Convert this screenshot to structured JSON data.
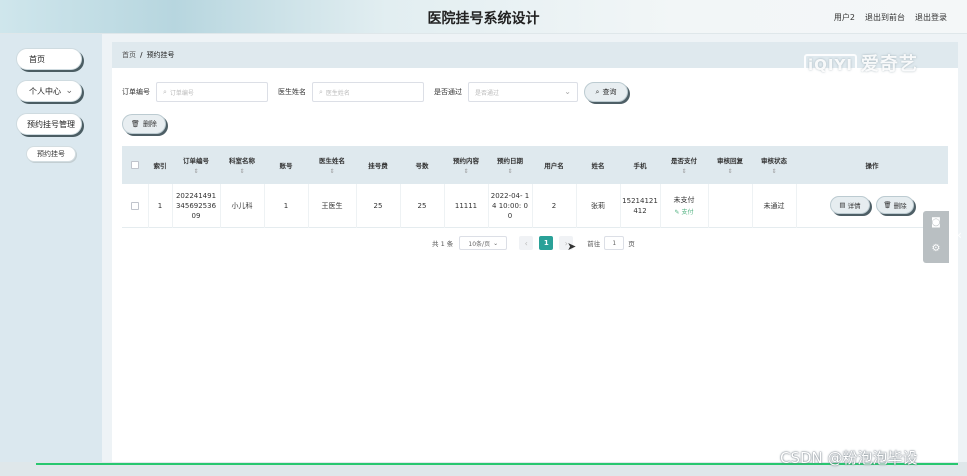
{
  "header": {
    "title": "医院挂号系统设计",
    "user": "用户2",
    "back_to_front": "退出到前台",
    "logout": "退出登录"
  },
  "sidebar": {
    "home": "首页",
    "personal_center": "个人中心",
    "booking_manage": "预约挂号管理",
    "booking": "预约挂号"
  },
  "breadcrumb": {
    "home": "首页",
    "sep": "/",
    "current": "预约挂号"
  },
  "watermark": {
    "box_text": "iQIYI",
    "brand": "爱奇艺"
  },
  "filters": {
    "order_label": "订单编号",
    "order_placeholder": "订单编号",
    "doctor_label": "医生姓名",
    "doctor_placeholder": "医生姓名",
    "pass_label": "是否通过",
    "pass_placeholder": "是否通过",
    "query_button": "查询",
    "delete_button": "删除"
  },
  "table": {
    "headers": [
      "索引",
      "订单编号",
      "科室名称",
      "账号",
      "医生姓名",
      "挂号费",
      "号数",
      "预约内容",
      "预约日期",
      "用户名",
      "姓名",
      "手机",
      "是否支付",
      "审核回复",
      "审核状态",
      "操作"
    ],
    "row": {
      "index": "1",
      "order_no": "202241491 345692536 09",
      "department": "小儿科",
      "account": "1",
      "doctor": "王医生",
      "fee": "25",
      "number": "25",
      "content": "11111",
      "date": "2022-04- 14 10:00: 00",
      "username": "2",
      "name": "张莉",
      "phone": "15214121 412",
      "paid": "未支付",
      "pay_link": "支付",
      "reply": "",
      "status": "未通过",
      "detail_button": "详情",
      "delete_button": "删除"
    }
  },
  "pager": {
    "total": "共 1 条",
    "page_size": "10条/页",
    "current_page": "1",
    "goto_label": "前往",
    "goto_value": "1",
    "page_unit": "页"
  },
  "footer": {
    "csdn": "CSDN @粉泡泡毕设"
  }
}
